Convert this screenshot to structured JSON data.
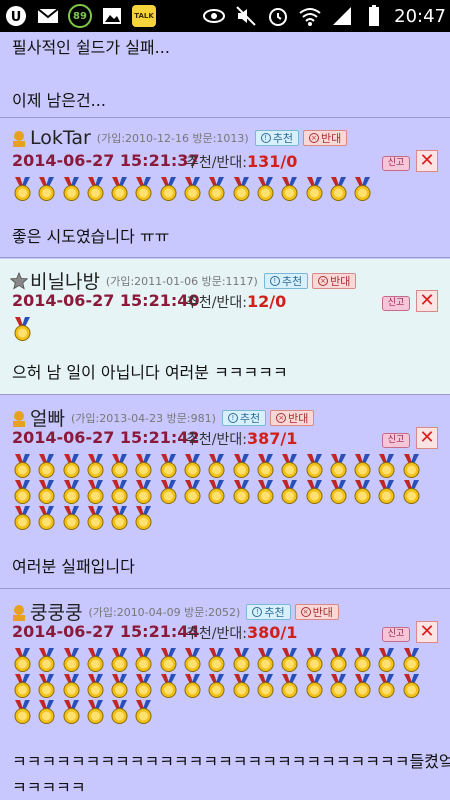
{
  "status_bar": {
    "badge_number": "89",
    "talk_label": "TALK",
    "time": "20:47",
    "icons": [
      "u-plus-icon",
      "mail-icon",
      "notification-count-icon",
      "image-icon",
      "kakaotalk-icon",
      "eye-icon",
      "mute-icon",
      "alarm-icon",
      "wifi-icon",
      "signal-icon",
      "battery-icon"
    ]
  },
  "top_text": {
    "line1": "필사적인 쉴드가 실패...",
    "line2": "이제 남은건..."
  },
  "labels": {
    "recommend": "추천",
    "oppose": "반대",
    "votes_label": "추천/반대:",
    "report": "신고",
    "delete": "✕"
  },
  "comments": [
    {
      "nickname": "LokTar",
      "meta": "(가입:2010-12-16 방문:1013)",
      "datetime": "2014-06-27 15:21:37",
      "votes": "131/0",
      "medal_count": 15,
      "text": "좋은 시도였습니다 ㅠㅠ"
    },
    {
      "nickname": "비닐나방",
      "meta": "(가입:2011-01-06 방문:1117)",
      "datetime": "2014-06-27 15:21:40",
      "votes": "12/0",
      "medal_count": 1,
      "text": "으허 남 일이 아닙니다 여러분 ㅋㅋㅋㅋㅋ"
    },
    {
      "nickname": "얼빠",
      "meta": "(가입:2013-04-23 방문:981)",
      "datetime": "2014-06-27 15:21:42",
      "votes": "387/1",
      "medal_count": 40,
      "text": "여러분 실패입니다"
    },
    {
      "nickname": "쿵쿵쿵",
      "meta": "(가입:2010-04-09 방문:2052)",
      "datetime": "2014-06-27 15:21:44",
      "votes": "380/1",
      "medal_count": 40,
      "text": "ㅋㅋㅋㅋㅋㅋㅋㅋㅋㅋㅋㅋㅋㅋㅋㅋㅋㅋㅋㅋㅋㅋㅋㅋㅋㅋㅋ들켰엌",
      "text2": "ㅋㅋㅋㅋㅋ"
    }
  ],
  "colors": {
    "background": "#c8c8ff",
    "highlight_background": "#e6f4f6",
    "date": "#8b1a3a",
    "votes": "#d0201a"
  }
}
